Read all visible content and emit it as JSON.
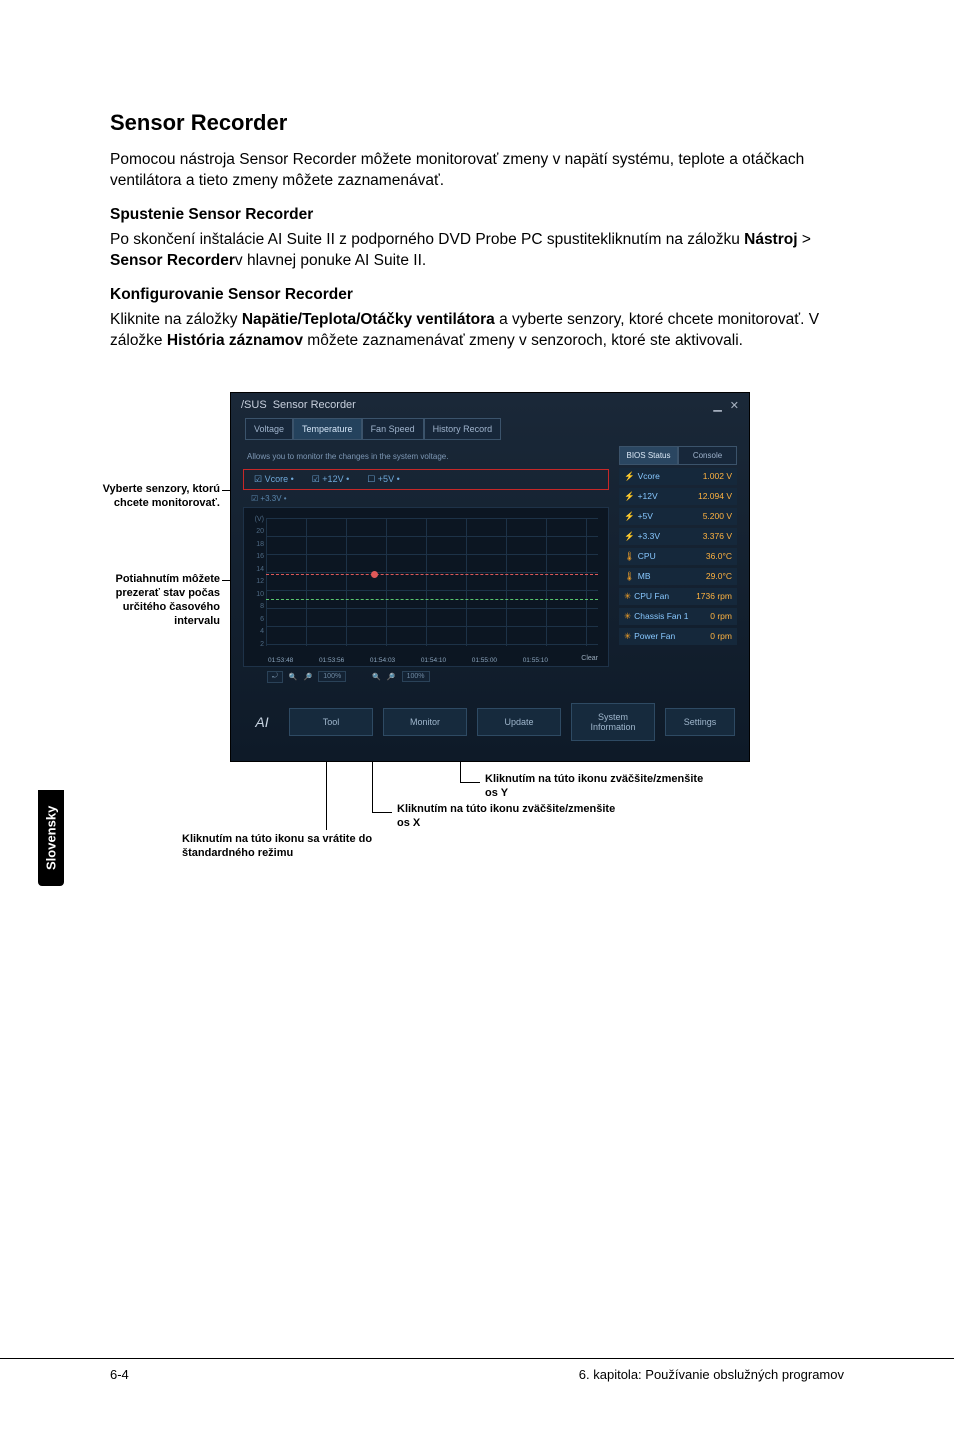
{
  "title": "Sensor Recorder",
  "intro": "Pomocou nástroja Sensor Recorder môžete monitorovať zmeny v napätí systému, teplote a otáčkach ventilátora a tieto zmeny môžete zaznamenávať.",
  "h2a": "Spustenie Sensor Recorder",
  "para_a_pre": "Po skončení inštalácie AI Suite II z podporného DVD Probe PC spustitekliknutím na záložku ",
  "para_a_b1": "Nástroj",
  "para_a_gt": " > ",
  "para_a_b2": "Sensor Recorder",
  "para_a_post": "v hlavnej ponuke AI Suite II.",
  "h2b": "Konfigurovanie Sensor Recorder",
  "para_b_pre": "Kliknite na záložky ",
  "para_b_b1": "Napätie/Teplota/Otáčky ventilátora",
  "para_b_mid": " a vyberte senzory, ktoré chcete monitorovať. V záložke ",
  "para_b_b2": "História záznamov",
  "para_b_post": " môžete zaznamenávať zmeny v senzoroch, ktoré ste aktivovali.",
  "label_select": "Vyberte senzory, ktorú chcete monitorovať.",
  "label_drag": "Potiahnutím môžete prezerať stav počas určitého časového intervalu",
  "callout_ybtn": "Kliknutím na túto ikonu zväčšite/zmenšite os Y",
  "callout_xbtn": "Kliknutím na túto ikonu zväčšite/zmenšite os X",
  "callout_reset": "Kliknutím na túto ikonu sa vrátite do štandardného režimu",
  "side_tab": "Slovensky",
  "footer_left": "6-4",
  "footer_right": "6. kapitola: Používanie obslužných programov",
  "ss": {
    "brand": "/SUS",
    "win_title": "Sensor Recorder",
    "tabs": [
      "Voltage",
      "Temperature",
      "Fan Speed",
      "History Record"
    ],
    "hint": "Allows you to monitor the changes in the system voltage.",
    "sensor_row": [
      "☑ Vcore •",
      "☑ +12V •",
      "☐ +5V •"
    ],
    "sensor_sel": "☑ +3.3V •",
    "ylabels": [
      "(V)",
      "20",
      "18",
      "16",
      "14",
      "12",
      "10",
      "8",
      "6",
      "4",
      "2"
    ],
    "xlabels": [
      "01:53:48",
      "01:53:56",
      "01:54:03",
      "01:54:10",
      "01:55:00",
      "01:55:10"
    ],
    "clear": "Clear",
    "zoom_y": "100%",
    "zoom_x": "100%",
    "right_tabs": [
      "BIOS Status",
      "Console"
    ],
    "stats": [
      {
        "icon": "⚡",
        "name": "Vcore",
        "val": "1.002 V"
      },
      {
        "icon": "⚡",
        "name": "+12V",
        "val": "12.094 V"
      },
      {
        "icon": "⚡",
        "name": "+5V",
        "val": "5.200 V"
      },
      {
        "icon": "⚡",
        "name": "+3.3V",
        "val": "3.376 V"
      },
      {
        "icon": "🌡",
        "name": "CPU",
        "val": "36.0°C"
      },
      {
        "icon": "🌡",
        "name": "MB",
        "val": "29.0°C"
      },
      {
        "icon": "✳",
        "name": "CPU Fan",
        "val": "1736 rpm"
      },
      {
        "icon": "✳",
        "name": "Chassis Fan 1",
        "val": "0 rpm"
      },
      {
        "icon": "✳",
        "name": "Power Fan",
        "val": "0 rpm"
      }
    ],
    "bottom_btns": [
      "Tool",
      "Monitor",
      "Update",
      "System Information"
    ],
    "settings": "Settings"
  }
}
